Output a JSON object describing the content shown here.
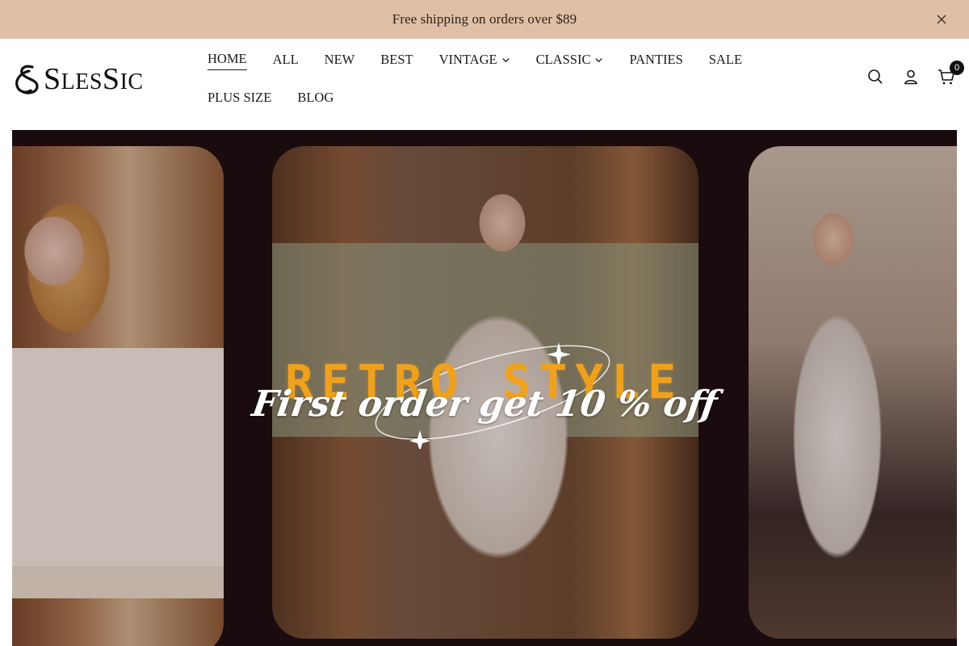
{
  "announcement": {
    "text": "Free shipping on orders over $89",
    "close_icon": "close-icon"
  },
  "header": {
    "logo": {
      "text_cap_s1": "S",
      "text_mid1": "LES",
      "text_cap_s2": "S",
      "text_end": "IC",
      "alt": "SlesSic"
    },
    "nav": {
      "row1": [
        {
          "label": "HOME",
          "active": true,
          "dropdown": false
        },
        {
          "label": "ALL",
          "active": false,
          "dropdown": false
        },
        {
          "label": "NEW",
          "active": false,
          "dropdown": false
        },
        {
          "label": "BEST",
          "active": false,
          "dropdown": false
        },
        {
          "label": "VINTAGE",
          "active": false,
          "dropdown": true
        },
        {
          "label": "CLASSIC",
          "active": false,
          "dropdown": true
        },
        {
          "label": "PANTIES",
          "active": false,
          "dropdown": false
        },
        {
          "label": "SALE",
          "active": false,
          "dropdown": false
        }
      ],
      "row2": [
        {
          "label": "PLUS SIZE",
          "active": false,
          "dropdown": false
        },
        {
          "label": "BLOG",
          "active": false,
          "dropdown": false
        }
      ]
    },
    "icons": {
      "search": "search-icon",
      "account": "user-icon",
      "cart": "cart-icon",
      "cart_count": "0"
    }
  },
  "hero": {
    "title": "RETRO STYLE",
    "subtitle": "First order get 10 % off"
  },
  "colors": {
    "announcement_bg": "#dfc0a6",
    "hero_title": "#f0a11c",
    "hero_subtitle": "#ffffff",
    "hero_bg": "#1a0d0f"
  }
}
